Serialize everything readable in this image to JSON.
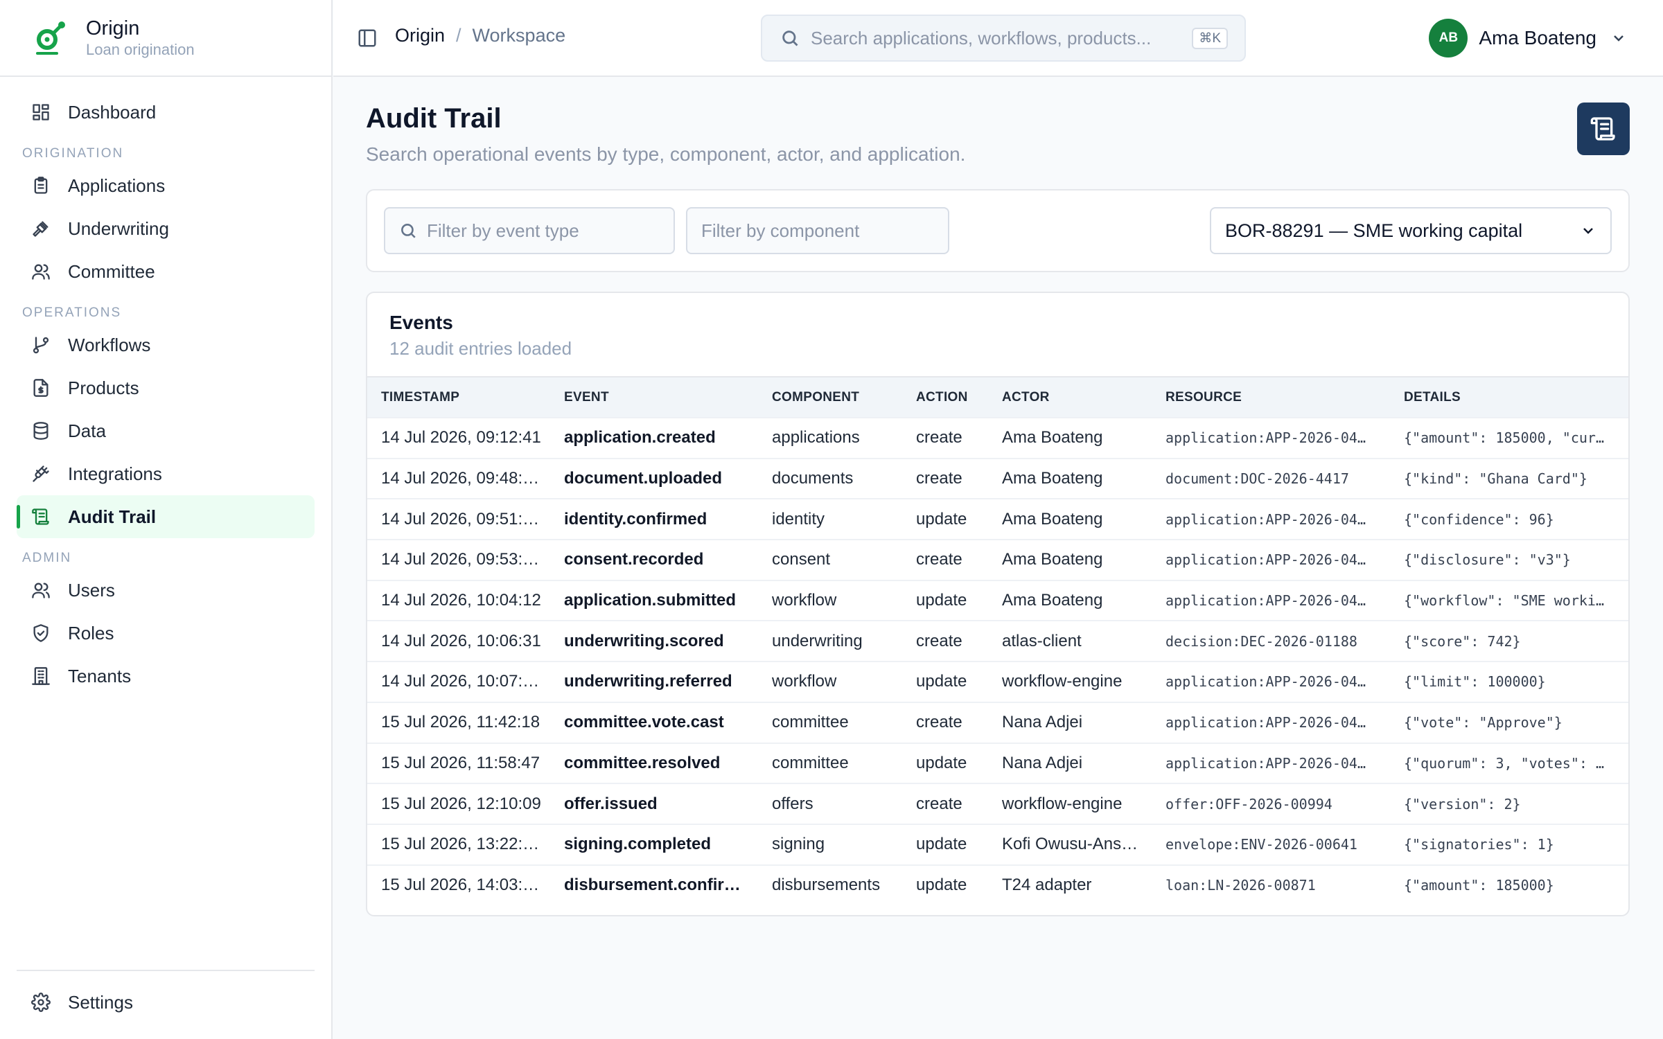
{
  "brand": {
    "name": "Origin",
    "subtitle": "Loan origination"
  },
  "nav": {
    "dashboard": "Dashboard",
    "section_origination": "ORIGINATION",
    "applications": "Applications",
    "underwriting": "Underwriting",
    "committee": "Committee",
    "section_operations": "OPERATIONS",
    "workflows": "Workflows",
    "products": "Products",
    "data": "Data",
    "integrations": "Integrations",
    "audit_trail": "Audit Trail",
    "section_admin": "ADMIN",
    "users": "Users",
    "roles": "Roles",
    "tenants": "Tenants",
    "settings": "Settings"
  },
  "topbar": {
    "breadcrumb_root": "Origin",
    "breadcrumb_sep": "/",
    "breadcrumb_current": "Workspace",
    "search_placeholder": "Search applications, workflows, products...",
    "search_shortcut": "⌘K",
    "user_initials": "AB",
    "user_name": "Ama Boateng"
  },
  "page": {
    "title": "Audit Trail",
    "subtitle": "Search operational events by type, component, actor, and application."
  },
  "filters": {
    "event_type_placeholder": "Filter by event type",
    "component_placeholder": "Filter by component",
    "application_selected": "BOR-88291 — SME working capital"
  },
  "events": {
    "title": "Events",
    "count_text": "12 audit entries loaded",
    "columns": [
      "TIMESTAMP",
      "EVENT",
      "COMPONENT",
      "ACTION",
      "ACTOR",
      "RESOURCE",
      "DETAILS"
    ],
    "rows": [
      [
        "14 Jul 2026, 09:12:41",
        "application.created",
        "applications",
        "create",
        "Ama Boateng",
        "application:APP-2026-04…",
        "{\"amount\": 185000, \"cur…"
      ],
      [
        "14 Jul 2026, 09:48:…",
        "document.uploaded",
        "documents",
        "create",
        "Ama Boateng",
        "document:DOC-2026-4417",
        "{\"kind\": \"Ghana Card\"}"
      ],
      [
        "14 Jul 2026, 09:51:…",
        "identity.confirmed",
        "identity",
        "update",
        "Ama Boateng",
        "application:APP-2026-04…",
        "{\"confidence\": 96}"
      ],
      [
        "14 Jul 2026, 09:53:…",
        "consent.recorded",
        "consent",
        "create",
        "Ama Boateng",
        "application:APP-2026-04…",
        "{\"disclosure\": \"v3\"}"
      ],
      [
        "14 Jul 2026, 10:04:12",
        "application.submitted",
        "workflow",
        "update",
        "Ama Boateng",
        "application:APP-2026-04…",
        "{\"workflow\": \"SME worki…"
      ],
      [
        "14 Jul 2026, 10:06:31",
        "underwriting.scored",
        "underwriting",
        "create",
        "atlas-client",
        "decision:DEC-2026-01188",
        "{\"score\": 742}"
      ],
      [
        "14 Jul 2026, 10:07:…",
        "underwriting.referred",
        "workflow",
        "update",
        "workflow-engine",
        "application:APP-2026-04…",
        "{\"limit\": 100000}"
      ],
      [
        "15 Jul 2026, 11:42:18",
        "committee.vote.cast",
        "committee",
        "create",
        "Nana Adjei",
        "application:APP-2026-04…",
        "{\"vote\": \"Approve\"}"
      ],
      [
        "15 Jul 2026, 11:58:47",
        "committee.resolved",
        "committee",
        "update",
        "Nana Adjei",
        "application:APP-2026-04…",
        "{\"quorum\": 3, \"votes\": …"
      ],
      [
        "15 Jul 2026, 12:10:09",
        "offer.issued",
        "offers",
        "create",
        "workflow-engine",
        "offer:OFF-2026-00994",
        "{\"version\": 2}"
      ],
      [
        "15 Jul 2026, 13:22:…",
        "signing.completed",
        "signing",
        "update",
        "Kofi Owusu-Ans…",
        "envelope:ENV-2026-00641",
        "{\"signatories\": 1}"
      ],
      [
        "15 Jul 2026, 14:03:…",
        "disbursement.confir…",
        "disbursements",
        "update",
        "T24 adapter",
        "loan:LN-2026-00871",
        "{\"amount\": 185000}"
      ]
    ]
  },
  "colors": {
    "accent": "#16a34a",
    "active_bg": "#ecfdf3",
    "primary_button": "#1e3a5f",
    "avatar": "#15803d"
  }
}
